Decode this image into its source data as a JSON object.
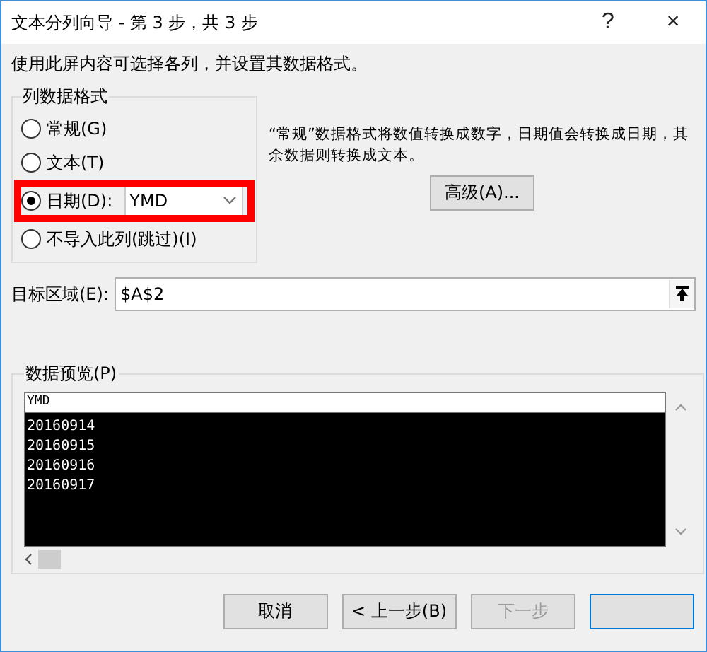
{
  "window": {
    "title": "文本分列向导 - 第 3 步，共 3 步",
    "help": "?",
    "close": "×"
  },
  "intro": "使用此屏内容可选择各列，并设置其数据格式。",
  "format_group": {
    "title": "列数据格式",
    "options": [
      {
        "label": "常规(G)",
        "selected": false,
        "kind": "plain"
      },
      {
        "label": "文本(T)",
        "selected": false,
        "kind": "plain"
      },
      {
        "label": "日期(D):",
        "selected": true,
        "kind": "date",
        "value": "YMD",
        "highlighted": true
      },
      {
        "label": "不导入此列(跳过)(I)",
        "selected": false,
        "kind": "plain"
      }
    ]
  },
  "description": "“常规”数据格式将数值转换成数字，日期值会转换成日期，其余数据则转换成文本。",
  "advanced_button": "高级(A)...",
  "destination": {
    "label": "目标区域(E):",
    "value": "$A$2"
  },
  "preview": {
    "title": "数据预览(P)",
    "header": "YMD",
    "rows": [
      "20160914",
      "20160915",
      "20160916",
      "20160917"
    ]
  },
  "buttons": [
    {
      "label": "取消",
      "disabled": false,
      "default": false
    },
    {
      "label": "< 上一步(B)",
      "disabled": false,
      "default": false
    },
    {
      "label": "下一步",
      "disabled": true,
      "default": false
    },
    {
      "disabled": false,
      "default": true
    }
  ]
}
